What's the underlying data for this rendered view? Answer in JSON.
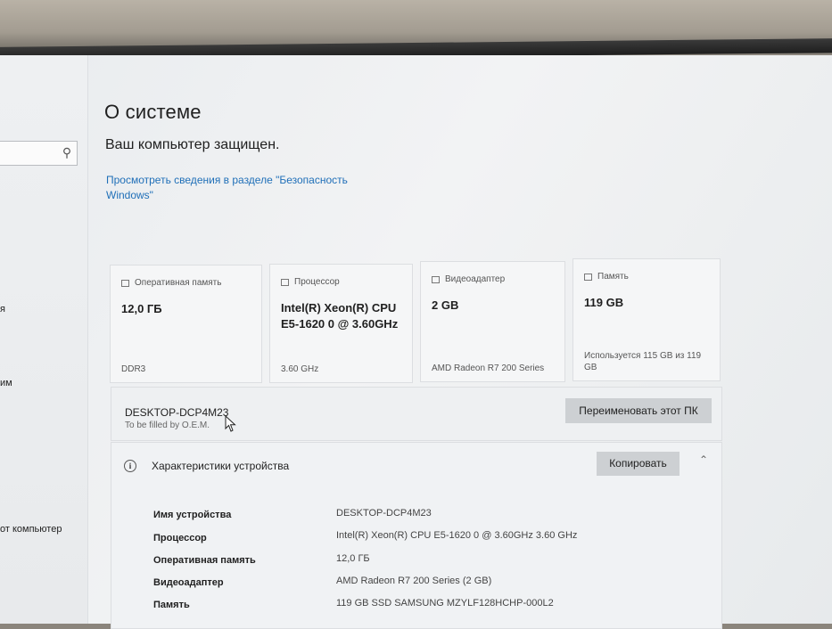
{
  "page": {
    "title": "О системе",
    "protected_text": "Ваш компьютер защищен.",
    "security_link": "Просмотреть сведения в разделе \"Безопасность Windows\""
  },
  "sidebar": {
    "items": [
      {
        "label": "я"
      },
      {
        "label": "им"
      },
      {
        "label": "от компьютер"
      }
    ]
  },
  "cards": {
    "ram": {
      "heading": "Оперативная память",
      "value": "12,0 ГБ",
      "foot": "DDR3"
    },
    "cpu": {
      "heading": "Процессор",
      "value": "Intel(R) Xeon(R) CPU E5-1620 0 @ 3.60GHz",
      "foot": "3.60 GHz"
    },
    "gpu": {
      "heading": "Видеоадаптер",
      "value": "2 GB",
      "foot": "AMD Radeon R7 200 Series"
    },
    "storage": {
      "heading": "Память",
      "value": "119 GB",
      "foot": "Используется 115 GB из 119 GB"
    }
  },
  "pc": {
    "name": "DESKTOP-DCP4M23",
    "oem": "To be filled by O.E.M.",
    "rename_button": "Переименовать этот ПК"
  },
  "specs": {
    "title": "Характеристики устройства",
    "copy_button": "Копировать",
    "rows": [
      {
        "label": "Имя устройства",
        "value": "DESKTOP-DCP4M23"
      },
      {
        "label": "Процессор",
        "value": "Intel(R) Xeon(R) CPU E5-1620 0 @ 3.60GHz   3.60 GHz"
      },
      {
        "label": "Оперативная память",
        "value": "12,0 ГБ"
      },
      {
        "label": "Видеоадаптер",
        "value": "AMD Radeon R7 200 Series (2 GB)"
      },
      {
        "label": "Память",
        "value": "119 GB SSD SAMSUNG MZYLF128HCHP-000L2"
      }
    ]
  }
}
